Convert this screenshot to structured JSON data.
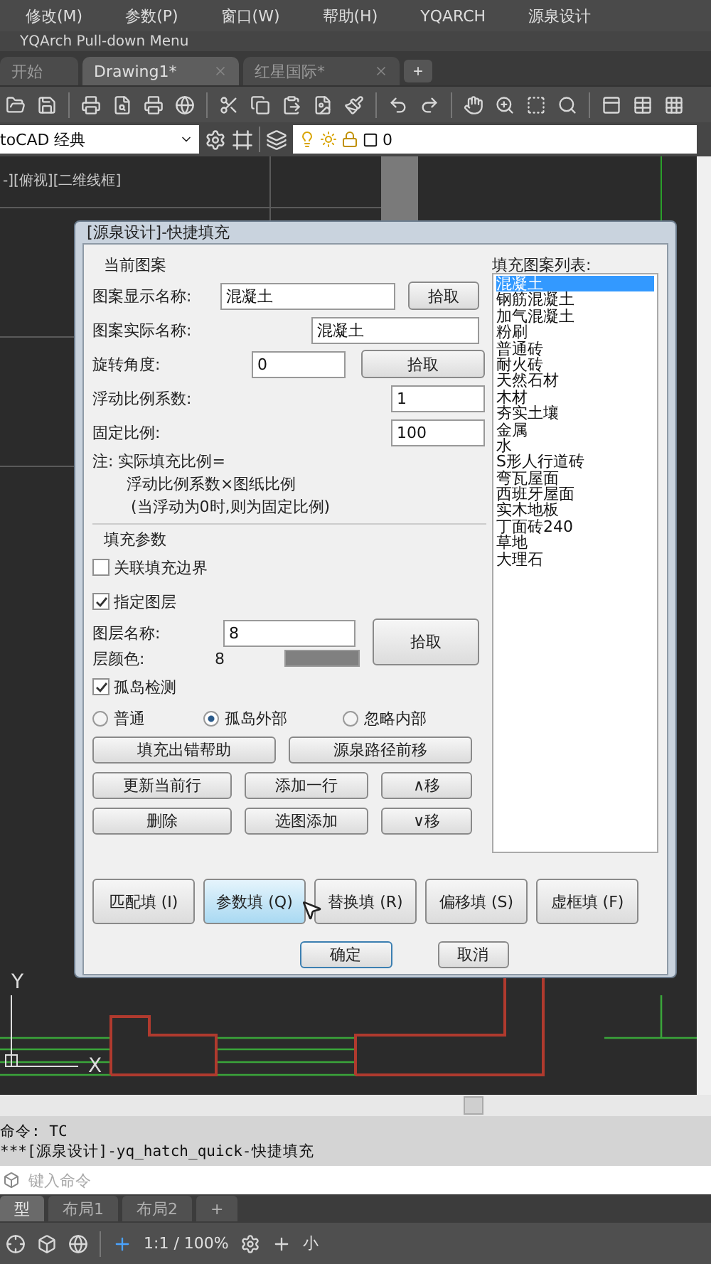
{
  "menu_bar": {
    "items": [
      "修改(M)",
      "参数(P)",
      "窗口(W)",
      "帮助(H)",
      "YQARCH",
      "源泉设计"
    ]
  },
  "menu_title": "YQArch Pull-down Menu",
  "file_tabs": [
    {
      "label": "开始",
      "selected": false,
      "closable": false
    },
    {
      "label": "Drawing1*",
      "selected": true,
      "closable": true
    },
    {
      "label": "红星国际*",
      "selected": false,
      "closable": true
    }
  ],
  "new_tab_button": "+",
  "workspace": {
    "value": "toCAD 经典"
  },
  "layer": {
    "value": "0"
  },
  "canvas": {
    "viewport_label": "-][俯视][二维线框]",
    "axis_y": "Y",
    "axis_x": "X"
  },
  "dialog": {
    "title": "[源泉设计]-快捷填充",
    "current_pattern": {
      "heading": "当前图案",
      "fields": [
        {
          "kind": "picked",
          "label": "图案显示名称:",
          "value": "混凝土",
          "button": "拾取"
        },
        {
          "kind": "wide",
          "label": "图案实际名称:",
          "value": "混凝土"
        },
        {
          "kind": "picked_short",
          "label": "旋转角度:",
          "value": "0",
          "button": "拾取"
        },
        {
          "kind": "small",
          "label": "浮动比例系数:",
          "value": "1"
        },
        {
          "kind": "small",
          "label": "固定比例:",
          "value": "100"
        }
      ],
      "note": [
        "注: 实际填充比例=",
        "浮动比例系数×图纸比例",
        "(当浮动为0时,则为固定比例)"
      ]
    },
    "fill_params": {
      "heading": "填充参数",
      "checkboxes": [
        {
          "label": "关联填充边界",
          "checked": false
        },
        {
          "label": "指定图层",
          "checked": true
        }
      ],
      "layer_name": {
        "label": "图层名称:",
        "value": "8"
      },
      "layer_color": {
        "label": "层颜色:",
        "value": "8",
        "color": "#808080"
      },
      "pick_button": "拾取",
      "island_check": {
        "label": "孤岛检测",
        "checked": true
      },
      "island_modes": [
        {
          "label": "普通",
          "selected": false
        },
        {
          "label": "孤岛外部",
          "selected": true
        },
        {
          "label": "忽略内部",
          "selected": false
        }
      ],
      "action_rows": [
        {
          "buttons": [
            "填充出错帮助",
            "源泉路径前移"
          ]
        },
        {
          "buttons": [
            "更新当前行",
            "添加一行",
            "∧移"
          ]
        },
        {
          "buttons": [
            "删除",
            "选图添加",
            "∨移"
          ]
        }
      ]
    },
    "pattern_list": {
      "heading": "填充图案列表:",
      "items": [
        {
          "label": "混凝土",
          "selected": true
        },
        {
          "label": "钢筋混凝土",
          "selected": false
        },
        {
          "label": "加气混凝土",
          "selected": false
        },
        {
          "label": "粉刷",
          "selected": false
        },
        {
          "label": "普通砖",
          "selected": false
        },
        {
          "label": "耐火砖",
          "selected": false
        },
        {
          "label": "天然石材",
          "selected": false
        },
        {
          "label": "木材",
          "selected": false
        },
        {
          "label": "夯实土壤",
          "selected": false
        },
        {
          "label": "金属",
          "selected": false
        },
        {
          "label": "水",
          "selected": false
        },
        {
          "label": "S形人行道砖",
          "selected": false
        },
        {
          "label": "弯瓦屋面",
          "selected": false
        },
        {
          "label": "西班牙屋面",
          "selected": false
        },
        {
          "label": "实木地板",
          "selected": false
        },
        {
          "label": "丁面砖240",
          "selected": false
        },
        {
          "label": "草地",
          "selected": false
        },
        {
          "label": "大理石",
          "selected": false
        }
      ]
    },
    "mode_buttons": [
      {
        "label": "匹配填 (I)",
        "hovered": false
      },
      {
        "label": "参数填 (Q)",
        "hovered": true
      },
      {
        "label": "替换填 (R)",
        "hovered": false
      },
      {
        "label": "偏移填 (S)",
        "hovered": false
      },
      {
        "label": "虚框填 (F)",
        "hovered": false
      }
    ],
    "footer_buttons": [
      {
        "label": "确定",
        "default": true
      },
      {
        "label": "取消",
        "default": false
      }
    ]
  },
  "command_history": [
    "命令: TC",
    "***[源泉设计]-yq_hatch_quick-快捷填充"
  ],
  "command_input": {
    "placeholder": "键入命令"
  },
  "layout_tabs": [
    {
      "label": "型",
      "selected": true
    },
    {
      "label": "布局1",
      "selected": false
    },
    {
      "label": "布局2",
      "selected": false
    }
  ],
  "new_layout_button": "+",
  "status_bar": {
    "scale": "1:1 / 100%",
    "text": "小"
  }
}
